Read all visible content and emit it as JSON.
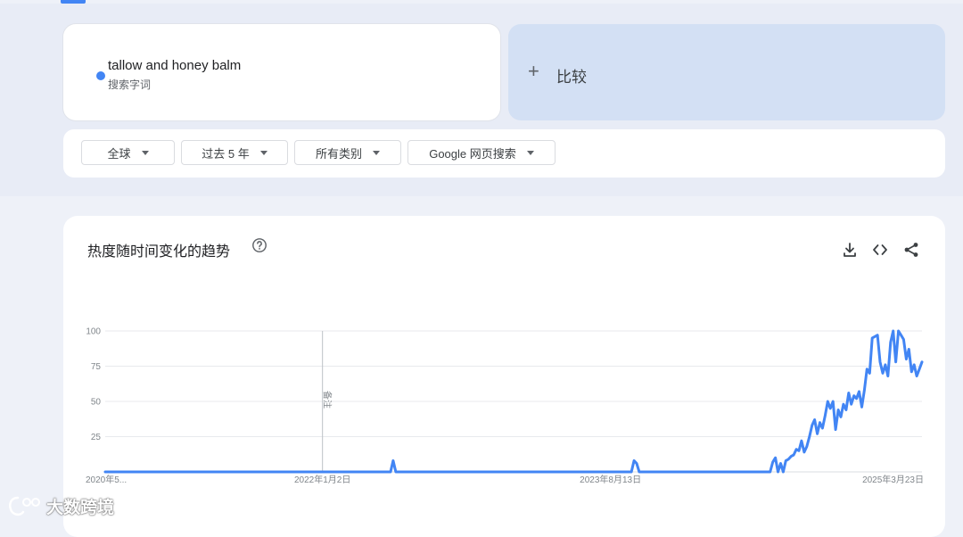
{
  "search_term": {
    "name": "tallow and honey balm",
    "type": "搜索字词",
    "color": "#4285f4"
  },
  "compare": {
    "plus": "+",
    "label": "比较"
  },
  "filters": [
    {
      "label": "全球"
    },
    {
      "label": "过去 5 年"
    },
    {
      "label": "所有类别"
    },
    {
      "label": "Google 网页搜索"
    }
  ],
  "interest_section": {
    "title": "热度随时间变化的趋势",
    "icons": [
      "help-icon",
      "download-icon",
      "embed-icon",
      "share-icon"
    ]
  },
  "chart_data": {
    "type": "line",
    "x_tick_labels": [
      "2020年5...",
      "2022年1月2日",
      "2023年8月13日",
      "2025年3月23日"
    ],
    "x_ticks_week_index": [
      0,
      83,
      193,
      255
    ],
    "y_ticks": [
      25,
      50,
      75,
      100
    ],
    "ylim": [
      0,
      100
    ],
    "grid": true,
    "note_label": "备注",
    "note_week_index": 83,
    "series": [
      {
        "color": "#4285f4",
        "values": [
          0,
          0,
          0,
          0,
          0,
          0,
          0,
          0,
          0,
          0,
          0,
          0,
          0,
          0,
          0,
          0,
          0,
          0,
          0,
          0,
          0,
          0,
          0,
          0,
          0,
          0,
          0,
          0,
          0,
          0,
          0,
          0,
          0,
          0,
          0,
          0,
          0,
          0,
          0,
          0,
          0,
          0,
          0,
          0,
          0,
          0,
          0,
          0,
          0,
          0,
          0,
          0,
          0,
          0,
          0,
          0,
          0,
          0,
          0,
          0,
          0,
          0,
          0,
          0,
          0,
          0,
          0,
          0,
          0,
          0,
          0,
          0,
          0,
          0,
          0,
          0,
          0,
          0,
          0,
          0,
          0,
          0,
          0,
          0,
          0,
          0,
          0,
          0,
          0,
          0,
          0,
          0,
          0,
          0,
          0,
          0,
          0,
          0,
          0,
          0,
          0,
          0,
          0,
          0,
          0,
          0,
          0,
          0,
          0,
          0,
          8,
          0,
          0,
          0,
          0,
          0,
          0,
          0,
          0,
          0,
          0,
          0,
          0,
          0,
          0,
          0,
          0,
          0,
          0,
          0,
          0,
          0,
          0,
          0,
          0,
          0,
          0,
          0,
          0,
          0,
          0,
          0,
          0,
          0,
          0,
          0,
          0,
          0,
          0,
          0,
          0,
          0,
          0,
          0,
          0,
          0,
          0,
          0,
          0,
          0,
          0,
          0,
          0,
          0,
          0,
          0,
          0,
          0,
          0,
          0,
          0,
          0,
          0,
          0,
          0,
          0,
          0,
          0,
          0,
          0,
          0,
          0,
          0,
          0,
          0,
          0,
          0,
          0,
          0,
          0,
          0,
          0,
          0,
          0,
          0,
          0,
          0,
          0,
          0,
          0,
          0,
          0,
          8,
          6,
          0,
          0,
          0,
          0,
          0,
          0,
          0,
          0,
          0,
          0,
          0,
          0,
          0,
          0,
          0,
          0,
          0,
          0,
          0,
          0,
          0,
          0,
          0,
          0,
          0,
          0,
          0,
          0,
          0,
          0,
          0,
          0,
          0,
          0,
          0,
          0,
          0,
          0,
          0,
          0,
          0,
          0,
          0,
          0,
          0,
          0,
          0,
          0,
          0,
          0,
          0,
          7,
          10,
          0,
          6,
          0,
          8,
          9,
          11,
          12,
          16,
          15,
          22,
          14,
          18,
          25,
          33,
          37,
          27,
          35,
          31,
          40,
          50,
          45,
          50,
          30,
          44,
          39,
          48,
          44,
          56,
          48,
          54,
          52,
          57,
          46,
          58,
          73,
          70,
          95,
          96,
          97,
          78,
          70,
          76,
          68,
          92,
          100,
          78,
          100,
          97,
          94,
          80,
          87,
          71,
          76,
          68,
          73,
          78
        ]
      }
    ]
  }
}
